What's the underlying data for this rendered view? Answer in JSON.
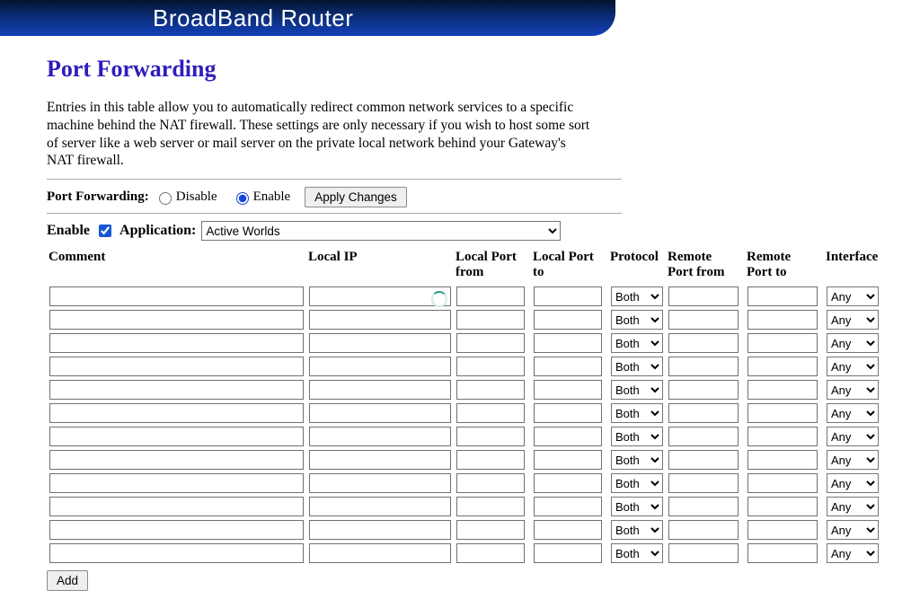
{
  "banner": {
    "title": "BroadBand Router"
  },
  "page": {
    "title": "Port Forwarding",
    "intro": "Entries in this table allow you to automatically redirect common network services to a specific machine behind the NAT firewall. These settings are only necessary if you wish to host some sort of server like a web server or mail server on the private local network behind your Gateway's NAT firewall."
  },
  "toggle": {
    "label": "Port Forwarding:",
    "disable_label": "Disable",
    "enable_label": "Enable",
    "selected": "enable",
    "apply_label": "Apply Changes"
  },
  "rule": {
    "enable_label": "Enable",
    "enable_checked": true,
    "application_label": "Application:",
    "application_selected": "Active Worlds"
  },
  "table": {
    "headers": {
      "comment": "Comment",
      "local_ip": "Local IP",
      "local_port_from": "Local Port from",
      "local_port_to": "Local Port to",
      "protocol": "Protocol",
      "remote_port_from": "Remote Port from",
      "remote_port_to": "Remote Port to",
      "interface": "Interface"
    },
    "protocol_default": "Both",
    "interface_default": "Any",
    "row_count": 12
  },
  "actions": {
    "add_label": "Add"
  }
}
